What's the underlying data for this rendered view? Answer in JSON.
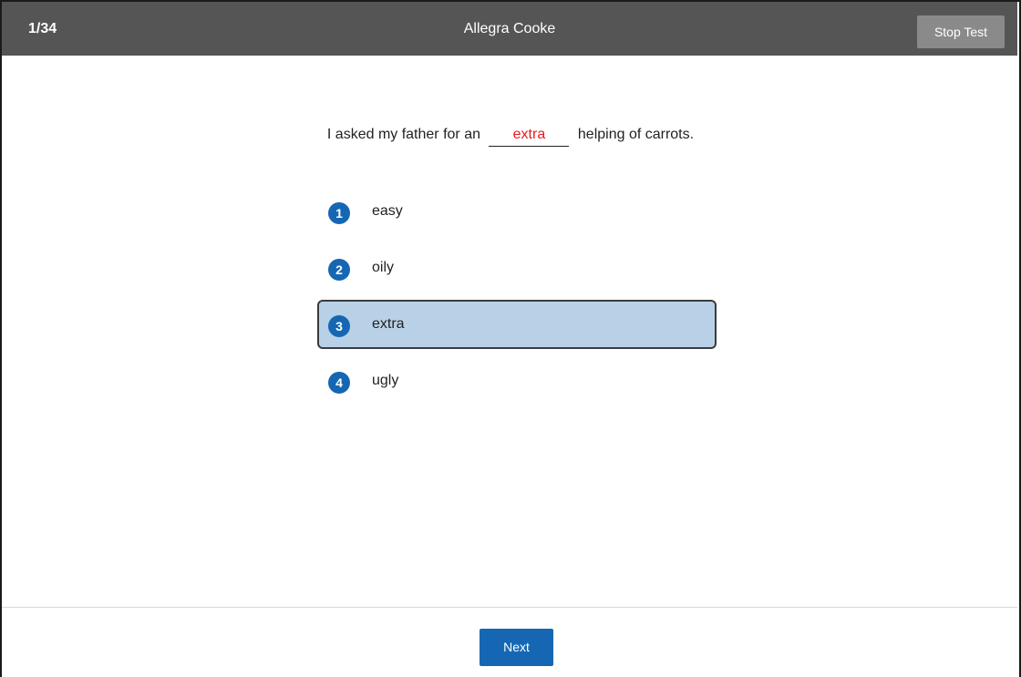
{
  "header": {
    "progress": "1/34",
    "student_name": "Allegra Cooke",
    "stop_label": "Stop Test"
  },
  "question": {
    "before": "I asked my father for an",
    "answer": "extra",
    "after": "helping of carrots."
  },
  "choices": [
    {
      "number": "1",
      "label": "easy",
      "selected": false
    },
    {
      "number": "2",
      "label": "oily",
      "selected": false
    },
    {
      "number": "3",
      "label": "extra",
      "selected": true
    },
    {
      "number": "4",
      "label": "ugly",
      "selected": false
    }
  ],
  "footer": {
    "next_label": "Next"
  },
  "colors": {
    "header_bg": "#555555",
    "accent": "#1667b3",
    "selected_bg": "#b8d1e7",
    "answer_text": "#e8191e"
  }
}
